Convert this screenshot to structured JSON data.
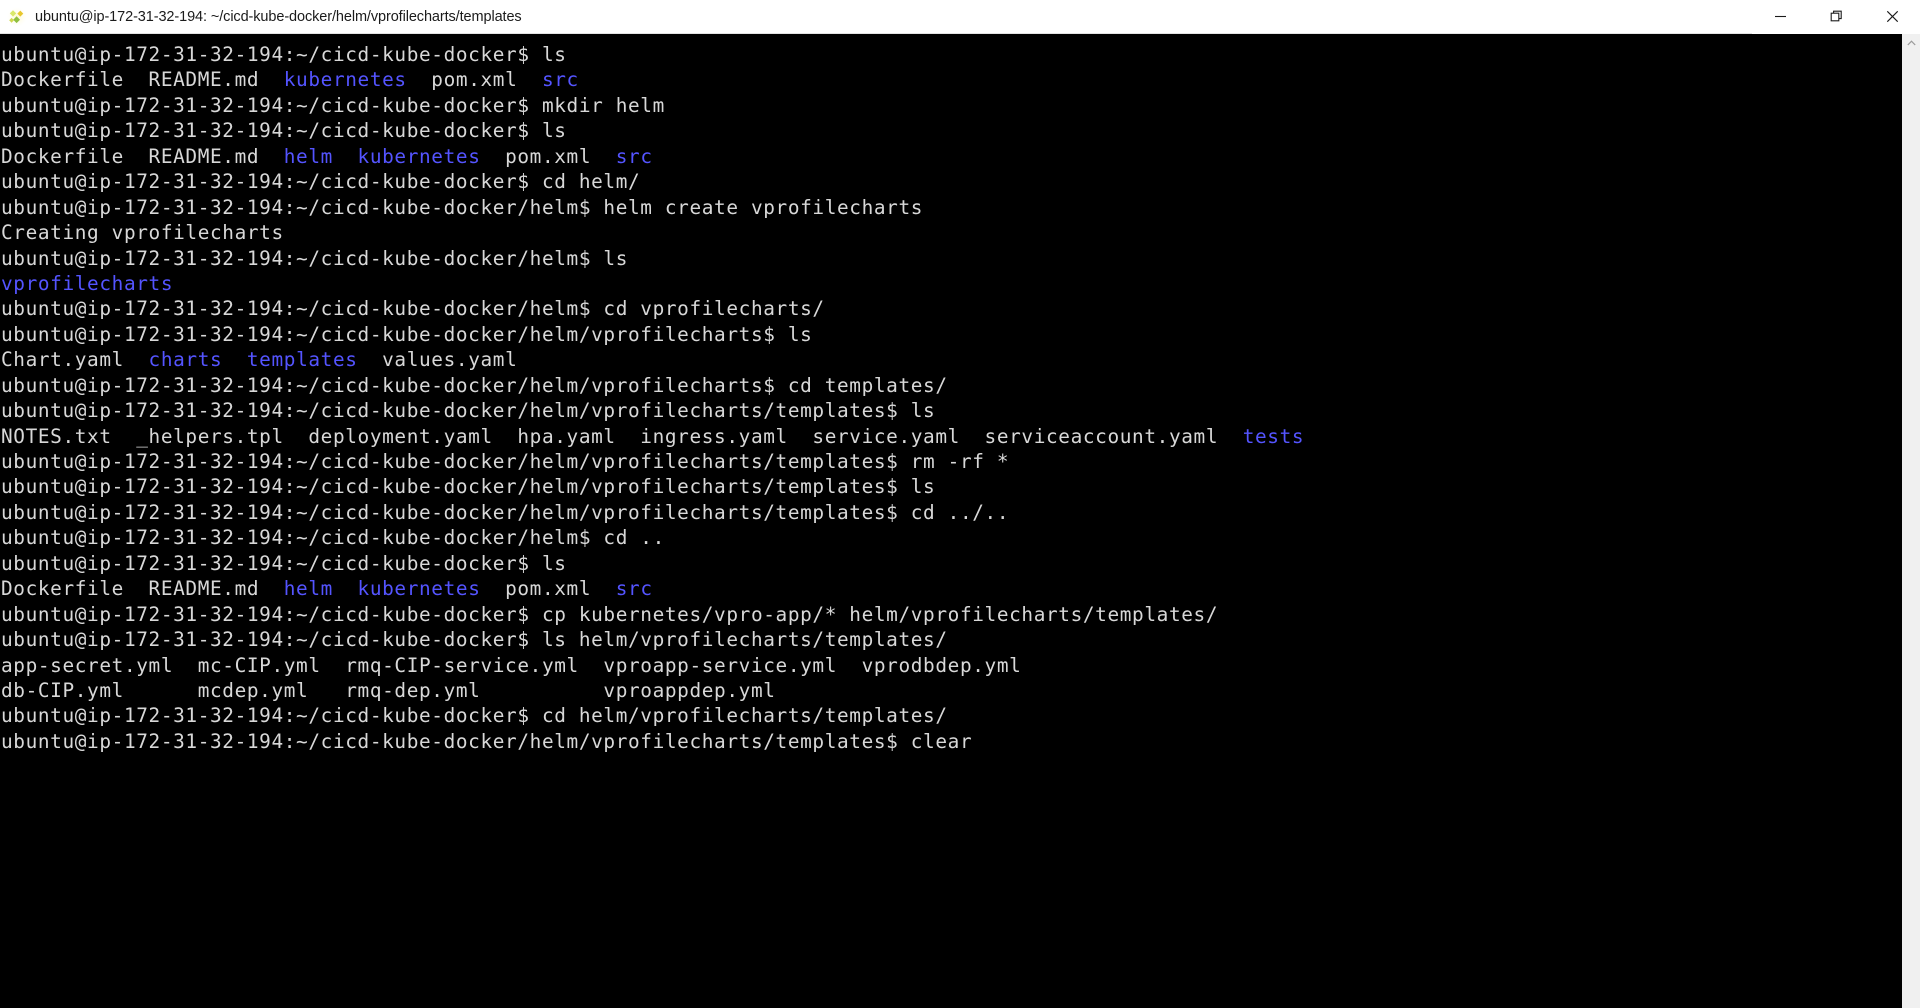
{
  "window": {
    "title": "ubuntu@ip-172-31-32-194: ~/cicd-kube-docker/helm/vprofilecharts/templates",
    "icon": "putty-icon",
    "controls": {
      "minimize": "minimize-button",
      "restore": "restore-button",
      "close": "close-button"
    }
  },
  "theme": {
    "terminal_bg": "#000000",
    "terminal_fg": "#d8d8d8",
    "directory_color": "#5454ff",
    "titlebar_bg": "#ffffff",
    "titlebar_fg": "#1b1b1b",
    "scrollbar_bg": "#f0f0f0"
  },
  "terminal": {
    "prompt_user_host": "ubuntu@ip-172-31-32-194",
    "lines": [
      {
        "segments": [
          {
            "t": "ubuntu@ip-172-31-32-194:~/cicd-kube-docker$ ls",
            "c": "w"
          }
        ]
      },
      {
        "segments": [
          {
            "t": "Dockerfile  README.md  ",
            "c": "w"
          },
          {
            "t": "kubernetes",
            "c": "dir"
          },
          {
            "t": "  pom.xml  ",
            "c": "w"
          },
          {
            "t": "src",
            "c": "dir"
          }
        ]
      },
      {
        "segments": [
          {
            "t": "ubuntu@ip-172-31-32-194:~/cicd-kube-docker$ mkdir helm",
            "c": "w"
          }
        ]
      },
      {
        "segments": [
          {
            "t": "ubuntu@ip-172-31-32-194:~/cicd-kube-docker$ ls",
            "c": "w"
          }
        ]
      },
      {
        "segments": [
          {
            "t": "Dockerfile  README.md  ",
            "c": "w"
          },
          {
            "t": "helm",
            "c": "dir"
          },
          {
            "t": "  ",
            "c": "w"
          },
          {
            "t": "kubernetes",
            "c": "dir"
          },
          {
            "t": "  pom.xml  ",
            "c": "w"
          },
          {
            "t": "src",
            "c": "dir"
          }
        ]
      },
      {
        "segments": [
          {
            "t": "ubuntu@ip-172-31-32-194:~/cicd-kube-docker$ cd helm/",
            "c": "w"
          }
        ]
      },
      {
        "segments": [
          {
            "t": "ubuntu@ip-172-31-32-194:~/cicd-kube-docker/helm$ helm create vprofilecharts",
            "c": "w"
          }
        ]
      },
      {
        "segments": [
          {
            "t": "Creating vprofilecharts",
            "c": "w"
          }
        ]
      },
      {
        "segments": [
          {
            "t": "ubuntu@ip-172-31-32-194:~/cicd-kube-docker/helm$ ls",
            "c": "w"
          }
        ]
      },
      {
        "segments": [
          {
            "t": "vprofilecharts",
            "c": "dir"
          }
        ]
      },
      {
        "segments": [
          {
            "t": "ubuntu@ip-172-31-32-194:~/cicd-kube-docker/helm$ cd vprofilecharts/",
            "c": "w"
          }
        ]
      },
      {
        "segments": [
          {
            "t": "ubuntu@ip-172-31-32-194:~/cicd-kube-docker/helm/vprofilecharts$ ls",
            "c": "w"
          }
        ]
      },
      {
        "segments": [
          {
            "t": "Chart.yaml  ",
            "c": "w"
          },
          {
            "t": "charts",
            "c": "dir"
          },
          {
            "t": "  ",
            "c": "w"
          },
          {
            "t": "templates",
            "c": "dir"
          },
          {
            "t": "  values.yaml",
            "c": "w"
          }
        ]
      },
      {
        "segments": [
          {
            "t": "ubuntu@ip-172-31-32-194:~/cicd-kube-docker/helm/vprofilecharts$ cd templates/",
            "c": "w"
          }
        ]
      },
      {
        "segments": [
          {
            "t": "ubuntu@ip-172-31-32-194:~/cicd-kube-docker/helm/vprofilecharts/templates$ ls",
            "c": "w"
          }
        ]
      },
      {
        "segments": [
          {
            "t": "NOTES.txt  _helpers.tpl  deployment.yaml  hpa.yaml  ingress.yaml  service.yaml  serviceaccount.yaml  ",
            "c": "w"
          },
          {
            "t": "tests",
            "c": "dir"
          }
        ]
      },
      {
        "segments": [
          {
            "t": "ubuntu@ip-172-31-32-194:~/cicd-kube-docker/helm/vprofilecharts/templates$ rm -rf *",
            "c": "w"
          }
        ]
      },
      {
        "segments": [
          {
            "t": "ubuntu@ip-172-31-32-194:~/cicd-kube-docker/helm/vprofilecharts/templates$ ls",
            "c": "w"
          }
        ]
      },
      {
        "segments": [
          {
            "t": "ubuntu@ip-172-31-32-194:~/cicd-kube-docker/helm/vprofilecharts/templates$ cd ../..",
            "c": "w"
          }
        ]
      },
      {
        "segments": [
          {
            "t": "ubuntu@ip-172-31-32-194:~/cicd-kube-docker/helm$ cd ..",
            "c": "w"
          }
        ]
      },
      {
        "segments": [
          {
            "t": "ubuntu@ip-172-31-32-194:~/cicd-kube-docker$ ls",
            "c": "w"
          }
        ]
      },
      {
        "segments": [
          {
            "t": "Dockerfile  README.md  ",
            "c": "w"
          },
          {
            "t": "helm",
            "c": "dir"
          },
          {
            "t": "  ",
            "c": "w"
          },
          {
            "t": "kubernetes",
            "c": "dir"
          },
          {
            "t": "  pom.xml  ",
            "c": "w"
          },
          {
            "t": "src",
            "c": "dir"
          }
        ]
      },
      {
        "segments": [
          {
            "t": "ubuntu@ip-172-31-32-194:~/cicd-kube-docker$ cp kubernetes/vpro-app/* helm/vprofilecharts/templates/",
            "c": "w"
          }
        ]
      },
      {
        "segments": [
          {
            "t": "ubuntu@ip-172-31-32-194:~/cicd-kube-docker$ ls helm/vprofilecharts/templates/",
            "c": "w"
          }
        ]
      },
      {
        "segments": [
          {
            "t": "app-secret.yml  mc-CIP.yml  rmq-CIP-service.yml  vproapp-service.yml  vprodbdep.yml",
            "c": "w"
          }
        ]
      },
      {
        "segments": [
          {
            "t": "db-CIP.yml      mcdep.yml   rmq-dep.yml          vproappdep.yml",
            "c": "w"
          }
        ]
      },
      {
        "segments": [
          {
            "t": "ubuntu@ip-172-31-32-194:~/cicd-kube-docker$ cd helm/vprofilecharts/templates/",
            "c": "w"
          }
        ]
      },
      {
        "segments": [
          {
            "t": "ubuntu@ip-172-31-32-194:~/cicd-kube-docker/helm/vprofilecharts/templates$ clear",
            "c": "w"
          }
        ]
      }
    ]
  },
  "scrollbar": {
    "up_arrow": "scroll-up-arrow",
    "position_percent": 100
  }
}
